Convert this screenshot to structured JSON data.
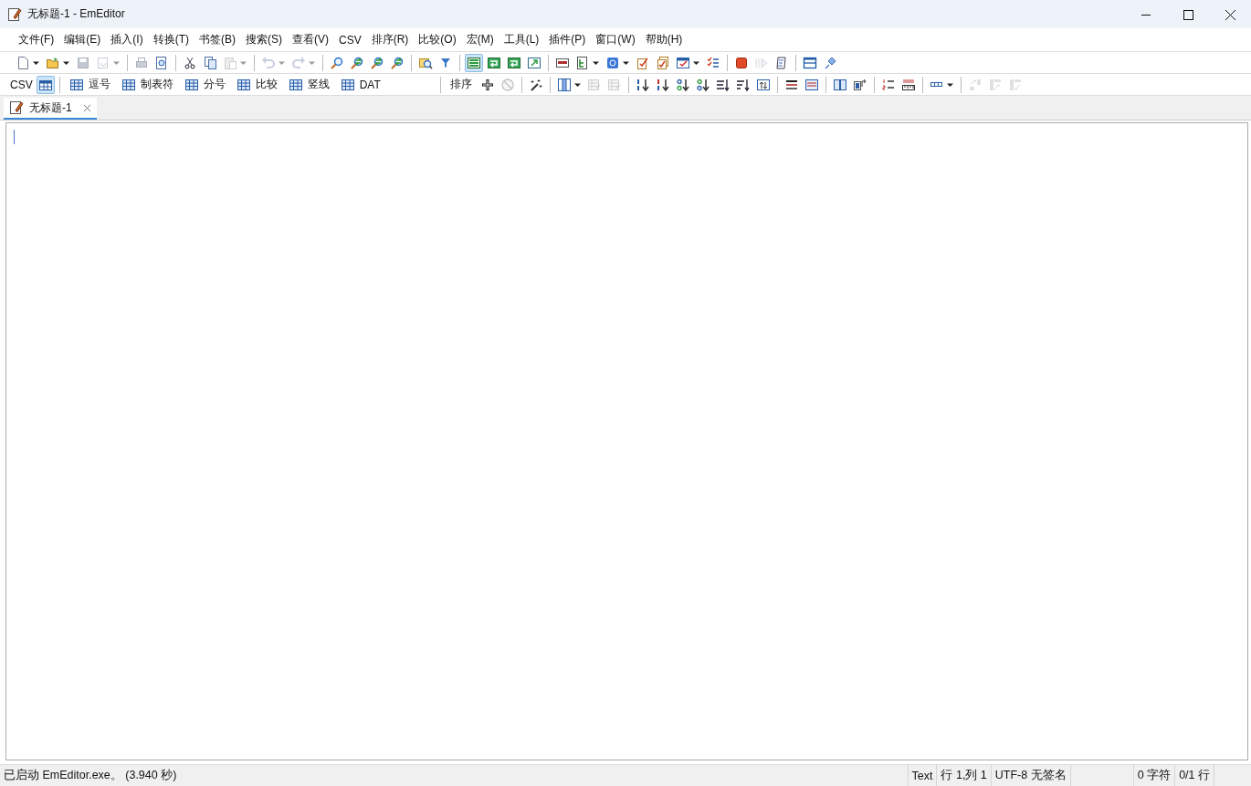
{
  "window": {
    "title": "无标题-1 - EmEditor"
  },
  "menu": [
    "文件(F)",
    "编辑(E)",
    "插入(I)",
    "转换(T)",
    "书签(B)",
    "搜索(S)",
    "查看(V)",
    "CSV",
    "排序(R)",
    "比较(O)",
    "宏(M)",
    "工具(L)",
    "插件(P)",
    "窗口(W)",
    "帮助(H)"
  ],
  "toolbar": [
    {
      "kind": "button",
      "disabled": false,
      "dropdown": true,
      "selected": false
    },
    {
      "kind": "button",
      "disabled": false,
      "dropdown": true,
      "selected": false
    },
    {
      "kind": "button",
      "disabled": true,
      "dropdown": false,
      "selected": false
    },
    {
      "kind": "button",
      "disabled": true,
      "dropdown": true,
      "selected": false
    },
    {
      "kind": "separator"
    },
    {
      "kind": "button",
      "disabled": true,
      "dropdown": false,
      "selected": false
    },
    {
      "kind": "button",
      "disabled": false,
      "dropdown": false,
      "selected": false
    },
    {
      "kind": "separator"
    },
    {
      "kind": "button",
      "disabled": false,
      "dropdown": false,
      "selected": false
    },
    {
      "kind": "button",
      "disabled": false,
      "dropdown": false,
      "selected": false
    },
    {
      "kind": "button",
      "disabled": true,
      "dropdown": true,
      "selected": false
    },
    {
      "kind": "separator"
    },
    {
      "kind": "button",
      "disabled": true,
      "dropdown": true,
      "selected": false
    },
    {
      "kind": "button",
      "disabled": true,
      "dropdown": true,
      "selected": false
    },
    {
      "kind": "separator"
    },
    {
      "kind": "button",
      "disabled": false,
      "dropdown": false,
      "selected": false
    },
    {
      "kind": "button",
      "disabled": false,
      "dropdown": false,
      "selected": false
    },
    {
      "kind": "button",
      "disabled": false,
      "dropdown": false,
      "selected": false
    },
    {
      "kind": "button",
      "disabled": false,
      "dropdown": false,
      "selected": false
    },
    {
      "kind": "separator"
    },
    {
      "kind": "button",
      "disabled": false,
      "dropdown": false,
      "selected": false
    },
    {
      "kind": "button",
      "disabled": false,
      "dropdown": false,
      "selected": false
    },
    {
      "kind": "separator"
    },
    {
      "kind": "button",
      "disabled": false,
      "dropdown": false,
      "selected": true
    },
    {
      "kind": "button",
      "disabled": false,
      "dropdown": false,
      "selected": false
    },
    {
      "kind": "button",
      "disabled": false,
      "dropdown": false,
      "selected": false
    },
    {
      "kind": "button",
      "disabled": false,
      "dropdown": false,
      "selected": false
    },
    {
      "kind": "separator"
    },
    {
      "kind": "button",
      "disabled": false,
      "dropdown": false,
      "selected": false
    },
    {
      "kind": "button",
      "disabled": false,
      "dropdown": true,
      "selected": false
    },
    {
      "kind": "button",
      "disabled": false,
      "dropdown": true,
      "selected": false
    },
    {
      "kind": "button",
      "disabled": false,
      "dropdown": false,
      "selected": false
    },
    {
      "kind": "button",
      "disabled": false,
      "dropdown": false,
      "selected": false
    },
    {
      "kind": "button",
      "disabled": false,
      "dropdown": true,
      "selected": false
    },
    {
      "kind": "button",
      "disabled": false,
      "dropdown": false,
      "selected": false
    },
    {
      "kind": "separator"
    },
    {
      "kind": "button",
      "disabled": false,
      "dropdown": false,
      "selected": false
    },
    {
      "kind": "button",
      "disabled": true,
      "dropdown": false,
      "selected": false
    },
    {
      "kind": "button",
      "disabled": false,
      "dropdown": false,
      "selected": false
    },
    {
      "kind": "separator"
    },
    {
      "kind": "button",
      "disabled": false,
      "dropdown": false,
      "selected": false
    },
    {
      "kind": "button",
      "disabled": false,
      "dropdown": false,
      "selected": false
    }
  ],
  "csv_toolbar": {
    "label": "CSV",
    "modes": [
      {
        "label": "逗号",
        "selected": false
      },
      {
        "label": "制表符",
        "selected": false
      },
      {
        "label": "分号",
        "selected": false
      },
      {
        "label": "比较",
        "selected": false
      },
      {
        "label": "竖线",
        "selected": false
      },
      {
        "label": "DAT",
        "selected": false
      }
    ],
    "grid_selected": true,
    "sort_label": "排序",
    "tools": [
      {
        "kind": "button",
        "disabled": false,
        "dropdown": false
      },
      {
        "kind": "button",
        "disabled": true,
        "dropdown": false
      },
      {
        "kind": "separator"
      },
      {
        "kind": "button",
        "disabled": false,
        "dropdown": false
      },
      {
        "kind": "separator"
      },
      {
        "kind": "button",
        "disabled": false,
        "dropdown": true
      },
      {
        "kind": "button",
        "disabled": true,
        "dropdown": false
      },
      {
        "kind": "button",
        "disabled": true,
        "dropdown": false
      },
      {
        "kind": "separator"
      },
      {
        "kind": "button",
        "disabled": false,
        "dropdown": false
      },
      {
        "kind": "button",
        "disabled": false,
        "dropdown": false
      },
      {
        "kind": "button",
        "disabled": false,
        "dropdown": false
      },
      {
        "kind": "button",
        "disabled": false,
        "dropdown": false
      },
      {
        "kind": "button",
        "disabled": false,
        "dropdown": false
      },
      {
        "kind": "button",
        "disabled": false,
        "dropdown": false
      },
      {
        "kind": "button",
        "disabled": false,
        "dropdown": false
      },
      {
        "kind": "separator"
      },
      {
        "kind": "button",
        "disabled": false,
        "dropdown": false
      },
      {
        "kind": "button",
        "disabled": false,
        "dropdown": false
      },
      {
        "kind": "separator"
      },
      {
        "kind": "button",
        "disabled": false,
        "dropdown": false
      },
      {
        "kind": "button",
        "disabled": false,
        "dropdown": false
      },
      {
        "kind": "separator"
      },
      {
        "kind": "button",
        "disabled": false,
        "dropdown": false
      },
      {
        "kind": "button",
        "disabled": false,
        "dropdown": false
      },
      {
        "kind": "separator"
      },
      {
        "kind": "button",
        "disabled": false,
        "dropdown": true
      },
      {
        "kind": "separator"
      },
      {
        "kind": "button",
        "disabled": true,
        "dropdown": false
      },
      {
        "kind": "button",
        "disabled": true,
        "dropdown": false
      },
      {
        "kind": "button",
        "disabled": true,
        "dropdown": false
      }
    ]
  },
  "tabs": [
    {
      "label": "无标题-1",
      "selected": true
    }
  ],
  "status_bar": {
    "message": "已启动 EmEditor.exe。 (3.940 秒)",
    "fields": [
      "Text",
      "行 1,列 1",
      "UTF-8 无签名",
      "0 字符",
      "0/1 行"
    ]
  }
}
